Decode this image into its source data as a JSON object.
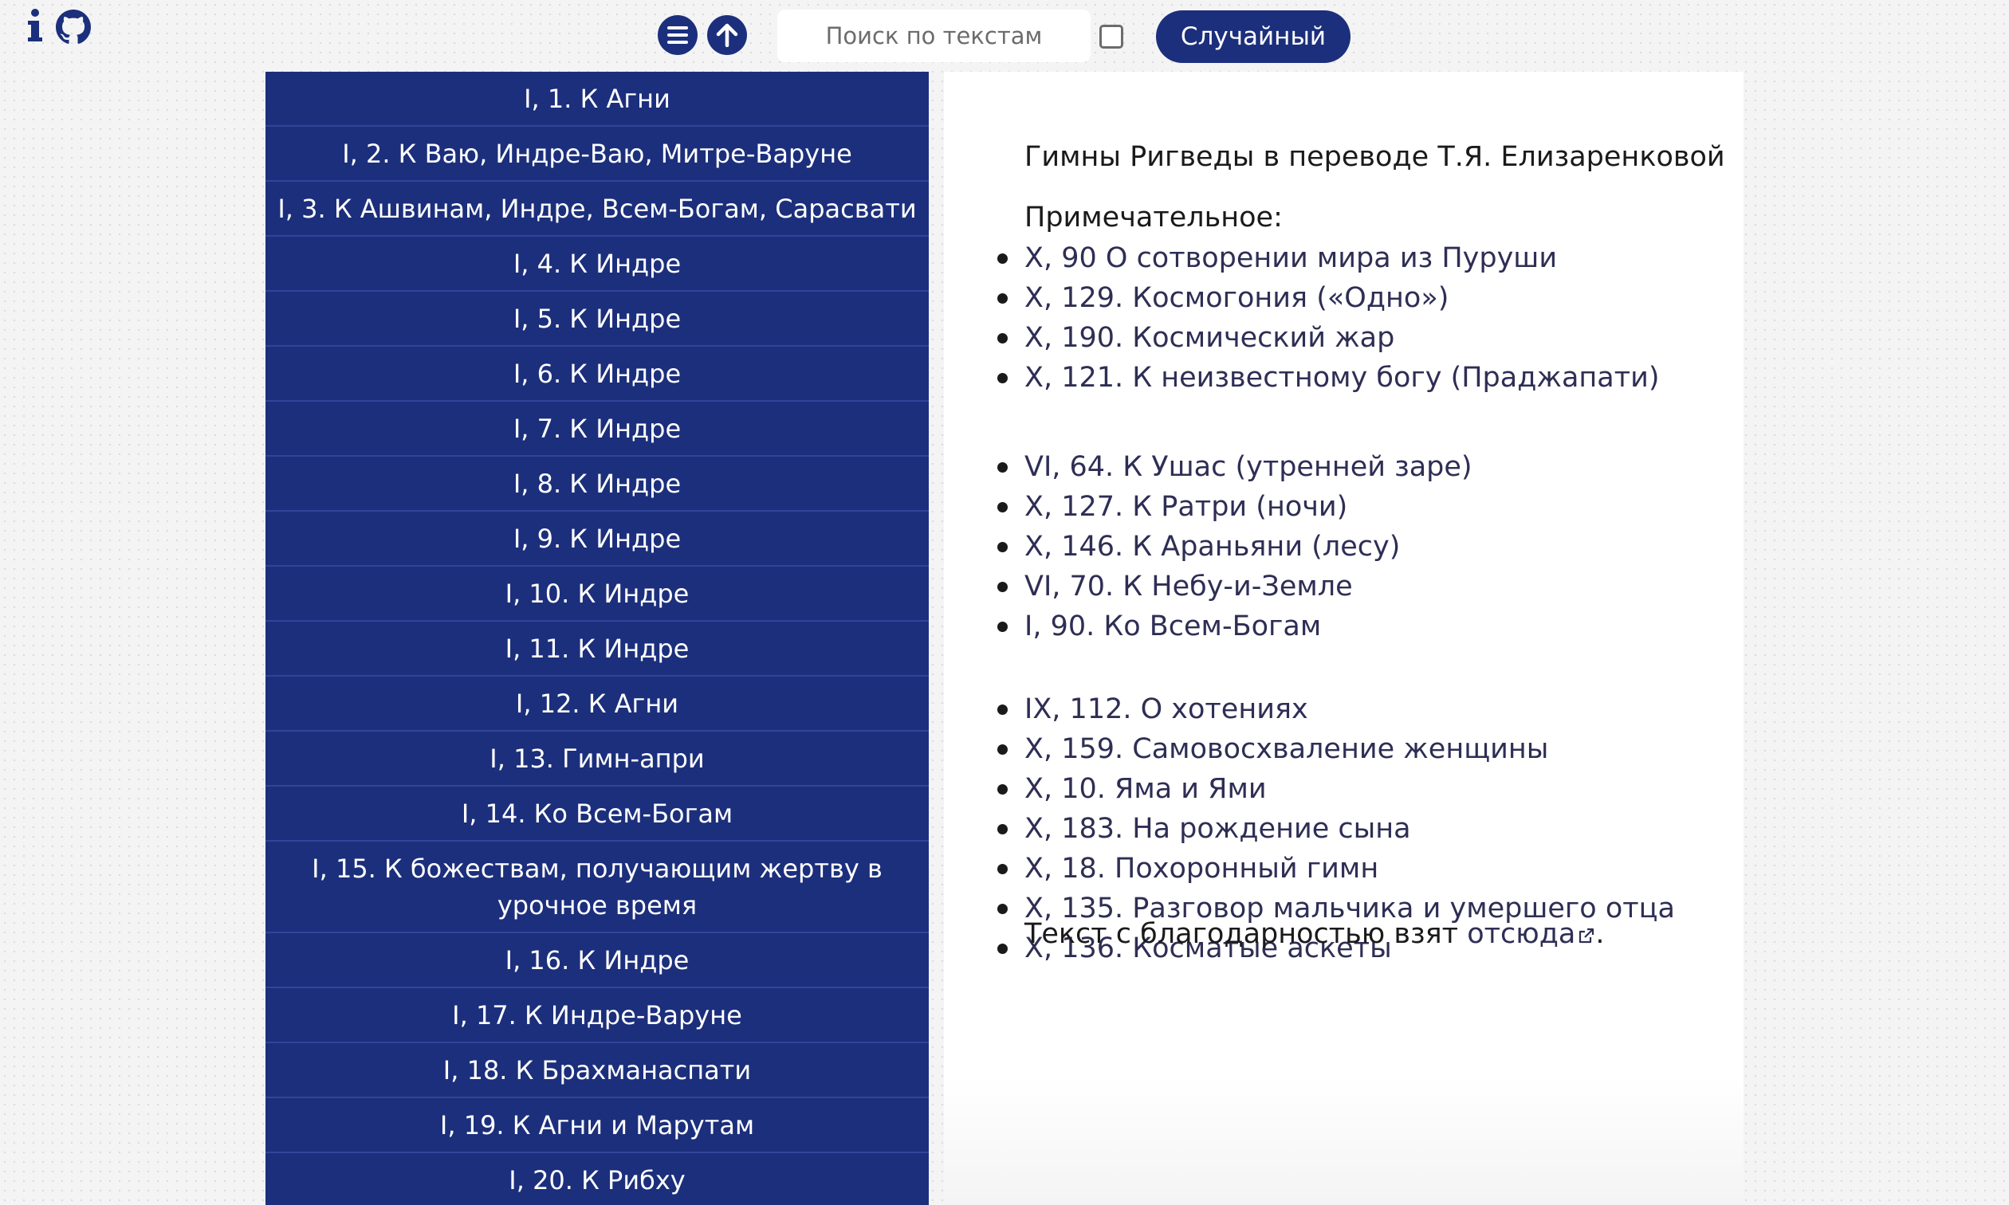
{
  "toolbar": {
    "search_placeholder": "Поиск по текстам",
    "random_label": "Случайный"
  },
  "sidebar": {
    "items": [
      "I, 1. К Агни",
      "I, 2. К Ваю, Индре-Ваю, Митре-Варуне",
      "I, 3. К Ашвинам, Индре, Всем-Богам, Сарасвати",
      "I, 4. К Индре",
      "I, 5. К Индре",
      "I, 6. К Индре",
      "I, 7. К Индре",
      "I, 8. К Индре",
      "I, 9. К Индре",
      "I, 10. К Индре",
      "I, 11. К Индре",
      "I, 12. К Агни",
      "I, 13. Гимн-апри",
      "I, 14. Ко Всем-Богам",
      "I, 15. К божествам, получающим жертву в урочное время",
      "I, 16. К Индре",
      "I, 17. К Индре-Варуне",
      "I, 18. К Брахманаспати",
      "I, 19. К Агни и Марутам",
      "I, 20. К Рибху"
    ]
  },
  "panel": {
    "title": "Гимны Ригведы в переводе Т.Я. Елизаренковой",
    "notable_heading": "Примечательное:",
    "groups": [
      [
        "X, 90 О сотворении мира из Пуруши",
        "X, 129. Космогония («Одно»)",
        "X, 190. Космический жар",
        "X, 121. К неизвестному богу (Праджапати)"
      ],
      [
        "VI, 64. К Ушас (утренней заре)",
        "X, 127. К Ратри (ночи)",
        "X, 146. К Араньяни (лесу)",
        "VI, 70. К Небу-и-Земле",
        "I, 90. Ко Всем-Богам"
      ],
      [
        "IX, 112. О хотениях",
        "X, 159. Самовосхваление женщины",
        "X, 10. Яма и Ями",
        "X, 183. На рождение сына",
        "X, 18. Похоронный гимн",
        "X, 135. Разговор мальчика и умершего отца",
        "X, 136. Косматые аскеты"
      ]
    ],
    "credit_text": "Текст с благодарностью взят ",
    "credit_link": "отсюда",
    "credit_end": "."
  }
}
